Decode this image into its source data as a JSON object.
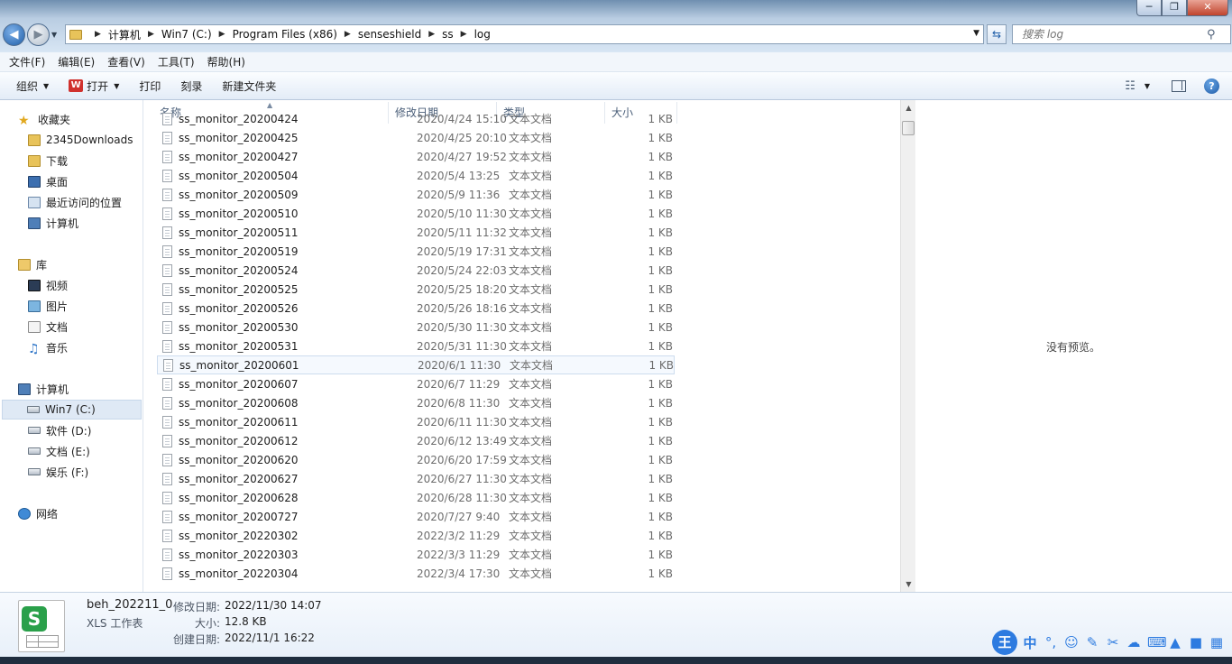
{
  "window": {
    "minimize": "─",
    "maximize": "❐",
    "close": "✕"
  },
  "address": {
    "crumbs": [
      "计算机",
      "Win7 (C:)",
      "Program Files (x86)",
      "senseshield",
      "ss",
      "log"
    ]
  },
  "search": {
    "placeholder": "搜索 log"
  },
  "menu": [
    "文件(F)",
    "编辑(E)",
    "查看(V)",
    "工具(T)",
    "帮助(H)"
  ],
  "toolbar": {
    "organize": "组织",
    "open": "打开",
    "wps_logo": "W",
    "print": "打印",
    "burn": "刻录",
    "new_folder": "新建文件夹"
  },
  "nav": {
    "favorites": "收藏夹",
    "fav_items": [
      "2345Downloads",
      "下载",
      "桌面",
      "最近访问的位置",
      "计算机"
    ],
    "libraries": "库",
    "lib_items": [
      "视频",
      "图片",
      "文档",
      "音乐"
    ],
    "computer": "计算机",
    "drives": [
      "Win7 (C:)",
      "软件 (D:)",
      "文档 (E:)",
      "娱乐 (F:)"
    ],
    "network": "网络"
  },
  "columns": {
    "name": "名称",
    "date": "修改日期",
    "type": "类型",
    "size": "大小"
  },
  "files": [
    {
      "name": "ss_monitor_20200424",
      "date": "2020/4/24 15:10",
      "type": "文本文档",
      "size": "1 KB"
    },
    {
      "name": "ss_monitor_20200425",
      "date": "2020/4/25 20:10",
      "type": "文本文档",
      "size": "1 KB"
    },
    {
      "name": "ss_monitor_20200427",
      "date": "2020/4/27 19:52",
      "type": "文本文档",
      "size": "1 KB"
    },
    {
      "name": "ss_monitor_20200504",
      "date": "2020/5/4 13:25",
      "type": "文本文档",
      "size": "1 KB"
    },
    {
      "name": "ss_monitor_20200509",
      "date": "2020/5/9 11:36",
      "type": "文本文档",
      "size": "1 KB"
    },
    {
      "name": "ss_monitor_20200510",
      "date": "2020/5/10 11:30",
      "type": "文本文档",
      "size": "1 KB"
    },
    {
      "name": "ss_monitor_20200511",
      "date": "2020/5/11 11:32",
      "type": "文本文档",
      "size": "1 KB"
    },
    {
      "name": "ss_monitor_20200519",
      "date": "2020/5/19 17:31",
      "type": "文本文档",
      "size": "1 KB"
    },
    {
      "name": "ss_monitor_20200524",
      "date": "2020/5/24 22:03",
      "type": "文本文档",
      "size": "1 KB"
    },
    {
      "name": "ss_monitor_20200525",
      "date": "2020/5/25 18:20",
      "type": "文本文档",
      "size": "1 KB"
    },
    {
      "name": "ss_monitor_20200526",
      "date": "2020/5/26 18:16",
      "type": "文本文档",
      "size": "1 KB"
    },
    {
      "name": "ss_monitor_20200530",
      "date": "2020/5/30 11:30",
      "type": "文本文档",
      "size": "1 KB"
    },
    {
      "name": "ss_monitor_20200531",
      "date": "2020/5/31 11:30",
      "type": "文本文档",
      "size": "1 KB"
    },
    {
      "name": "ss_monitor_20200601",
      "date": "2020/6/1 11:30",
      "type": "文本文档",
      "size": "1 KB"
    },
    {
      "name": "ss_monitor_20200607",
      "date": "2020/6/7 11:29",
      "type": "文本文档",
      "size": "1 KB"
    },
    {
      "name": "ss_monitor_20200608",
      "date": "2020/6/8 11:30",
      "type": "文本文档",
      "size": "1 KB"
    },
    {
      "name": "ss_monitor_20200611",
      "date": "2020/6/11 11:30",
      "type": "文本文档",
      "size": "1 KB"
    },
    {
      "name": "ss_monitor_20200612",
      "date": "2020/6/12 13:49",
      "type": "文本文档",
      "size": "1 KB"
    },
    {
      "name": "ss_monitor_20200620",
      "date": "2020/6/20 17:59",
      "type": "文本文档",
      "size": "1 KB"
    },
    {
      "name": "ss_monitor_20200627",
      "date": "2020/6/27 11:30",
      "type": "文本文档",
      "size": "1 KB"
    },
    {
      "name": "ss_monitor_20200628",
      "date": "2020/6/28 11:30",
      "type": "文本文档",
      "size": "1 KB"
    },
    {
      "name": "ss_monitor_20200727",
      "date": "2020/7/27 9:40",
      "type": "文本文档",
      "size": "1 KB"
    },
    {
      "name": "ss_monitor_20220302",
      "date": "2022/3/2 11:29",
      "type": "文本文档",
      "size": "1 KB"
    },
    {
      "name": "ss_monitor_20220303",
      "date": "2022/3/3 11:29",
      "type": "文本文档",
      "size": "1 KB"
    },
    {
      "name": "ss_monitor_20220304",
      "date": "2022/3/4 17:30",
      "type": "文本文档",
      "size": "1 KB"
    }
  ],
  "preview": {
    "empty_text": "没有预览。"
  },
  "details": {
    "icon_letter": "S",
    "filename": "beh_202211_0",
    "filetype": "XLS 工作表",
    "modified_label": "修改日期:",
    "modified_value": "2022/11/30 14:07",
    "size_label": "大小:",
    "size_value": "12.8 KB",
    "created_label": "创建日期:",
    "created_value": "2022/11/1 16:22"
  },
  "ime": {
    "logo": "王",
    "mode": "中"
  }
}
